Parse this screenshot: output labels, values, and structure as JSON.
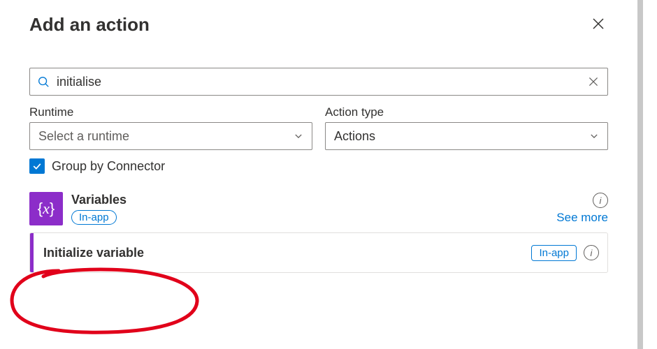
{
  "header": {
    "title": "Add an action"
  },
  "search": {
    "value": "initialise"
  },
  "filters": {
    "runtime": {
      "label": "Runtime",
      "placeholder": "Select a runtime"
    },
    "action_type": {
      "label": "Action type",
      "value": "Actions"
    }
  },
  "group": {
    "label": "Group by Connector",
    "checked": true
  },
  "connector": {
    "name": "Variables",
    "badge": "In-app",
    "see_more": "See more"
  },
  "action": {
    "name": "Initialize variable",
    "badge": "In-app"
  }
}
